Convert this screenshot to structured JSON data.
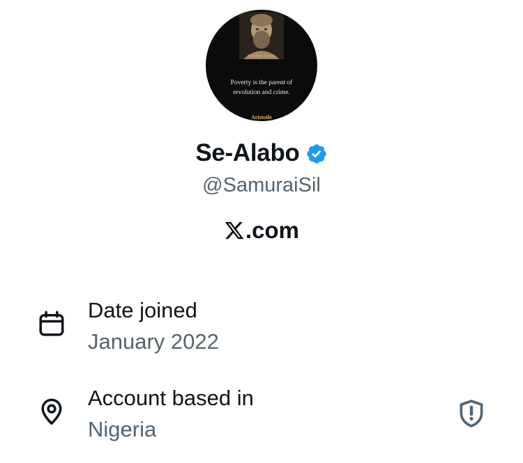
{
  "profile": {
    "avatar": {
      "brand": "Wisdom Waves",
      "quote": "Poverty is the parent of revolution and crime.",
      "author": "Aristotle"
    },
    "display_name": "Se-Alabo",
    "verified_icon": "verified-badge-icon",
    "handle": "@SamuraiSil",
    "site_logo_icon": "x-logo-icon",
    "site_suffix": ".com"
  },
  "about": {
    "date_joined": {
      "icon": "calendar-icon",
      "label": "Date joined",
      "value": "January 2022"
    },
    "account_based_in": {
      "icon": "location-pin-icon",
      "label": "Account based in",
      "value": "Nigeria",
      "info_icon": "shield-alert-icon"
    }
  },
  "colors": {
    "primary_text": "#0f1419",
    "secondary_text": "#536471",
    "verified_blue": "#1d9bf0",
    "background": "#ffffff"
  }
}
